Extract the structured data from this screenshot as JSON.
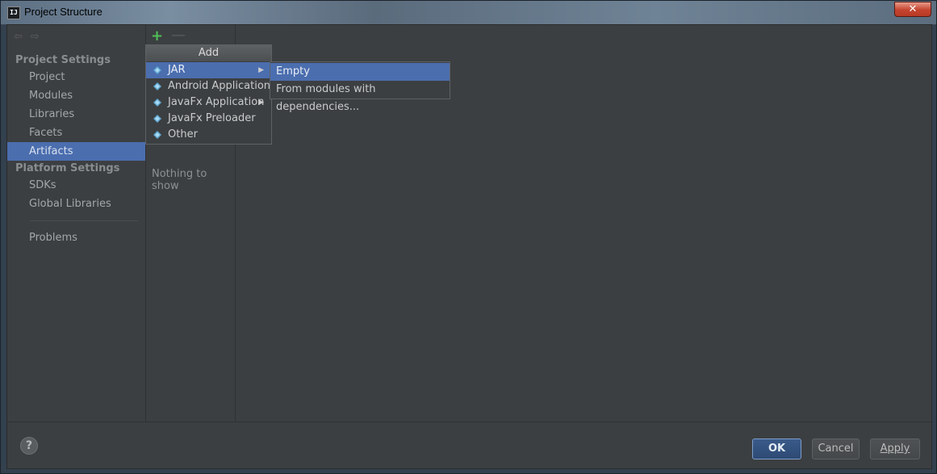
{
  "window": {
    "title": "Project Structure",
    "logo_text": "IJ",
    "close_label": "✕"
  },
  "nav": {
    "back_icon": "⇦",
    "forward_icon": "⇨"
  },
  "sidebar": {
    "project_settings_title": "Project Settings",
    "project_items": [
      {
        "label": "Project"
      },
      {
        "label": "Modules"
      },
      {
        "label": "Libraries"
      },
      {
        "label": "Facets"
      },
      {
        "label": "Artifacts",
        "selected": true
      }
    ],
    "platform_settings_title": "Platform Settings",
    "platform_items": [
      {
        "label": "SDKs"
      },
      {
        "label": "Global Libraries"
      }
    ],
    "problems_label": "Problems"
  },
  "artifacts_panel": {
    "add_icon": "+",
    "remove_icon": "—",
    "empty_text": "Nothing to show"
  },
  "add_menu": {
    "header": "Add",
    "items": [
      {
        "label": "JAR",
        "has_submenu": true,
        "highlighted": true
      },
      {
        "label": "Android Application",
        "has_submenu": false
      },
      {
        "label": "JavaFx Application",
        "has_submenu": true
      },
      {
        "label": "JavaFx Preloader",
        "has_submenu": false
      },
      {
        "label": "Other",
        "has_submenu": false
      }
    ]
  },
  "jar_submenu": {
    "items": [
      {
        "label": "Empty",
        "highlighted": true
      },
      {
        "label": "From modules with dependencies..."
      }
    ]
  },
  "footer": {
    "help_label": "?",
    "ok_label": "OK",
    "cancel_label": "Cancel",
    "apply_label": "Apply"
  },
  "colors": {
    "selection": "#4b6eaf",
    "panel_bg": "#3c3f41",
    "add_icon": "#4fbf56",
    "artifact_diamond": "#5fa8d3"
  }
}
